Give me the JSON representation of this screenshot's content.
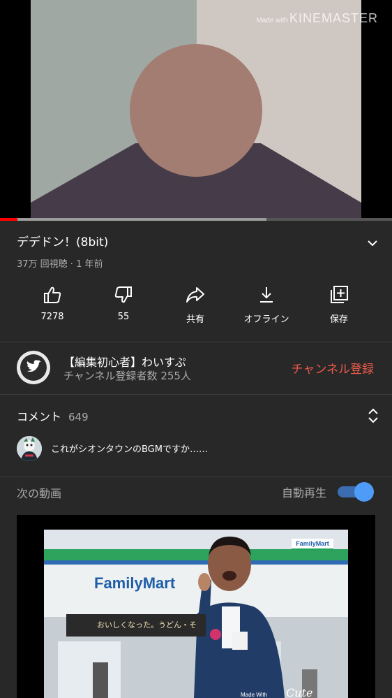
{
  "player": {
    "watermark_small": "Made with",
    "watermark_big": "KINEMASTER",
    "progress_played_fraction": 0.045,
    "progress_buffered_fraction": 0.68,
    "colors": {
      "left_bg": "#a0a8a3",
      "right_bg": "#cfc8c2",
      "circle": "#a47d72",
      "shoulders": "#463b48"
    }
  },
  "video": {
    "title": "デデドン！(8bit)",
    "meta": "37万 回視聴 · 1 年前"
  },
  "actions": [
    {
      "icon": "thumbs-up-icon",
      "label": "7278"
    },
    {
      "icon": "thumbs-down-icon",
      "label": "55"
    },
    {
      "icon": "share-icon",
      "label": "共有"
    },
    {
      "icon": "download-icon",
      "label": "オフライン"
    },
    {
      "icon": "save-playlist-icon",
      "label": "保存"
    }
  ],
  "channel": {
    "name": "【編集初心者】わいすぷ",
    "subscribers": "チャンネル登録者数 255人",
    "subscribe_label": "チャンネル登録",
    "subscribe_color": "#ef5a4c"
  },
  "comments": {
    "header": "コメント",
    "count": "649",
    "top_comment": "これがシオンタウンのBGMですか……"
  },
  "up_next": {
    "label": "次の動画",
    "autoplay_label": "自動再生",
    "autoplay_on": true,
    "thumbnail": {
      "brand": "FamilyMart",
      "badge": "FamilyMart",
      "sign_text": "おいしくなった。うどん・そ",
      "caption": "Cute",
      "madewith": "Made With"
    }
  }
}
